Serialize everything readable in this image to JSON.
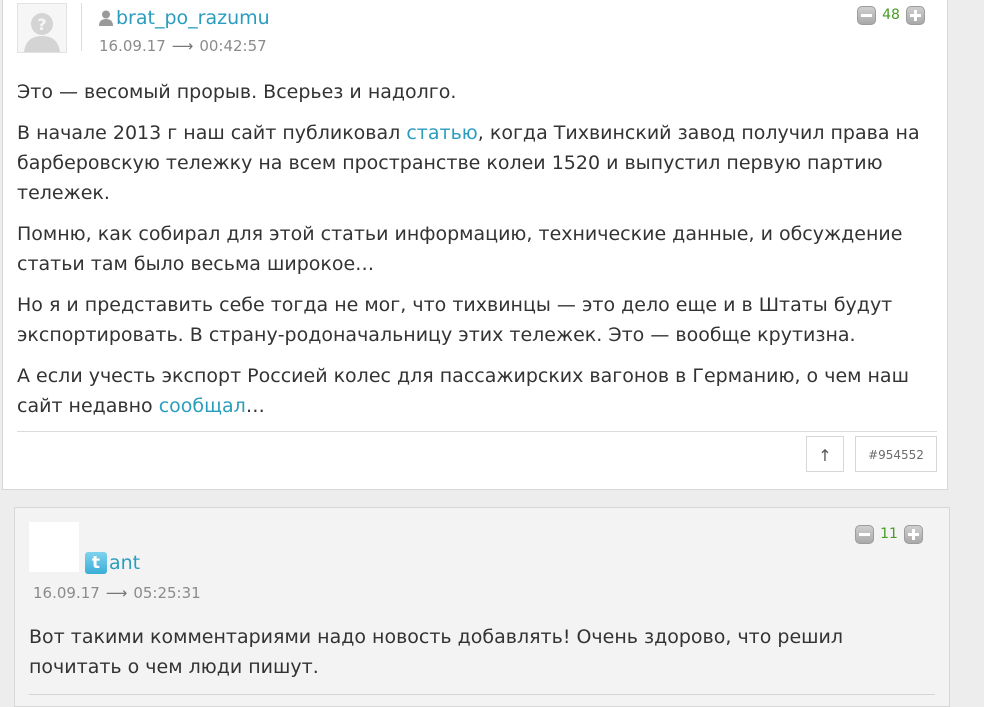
{
  "comment1": {
    "author": "brat_po_razumu",
    "date": "16.09.17",
    "time": "00:42:57",
    "arrow": "⟶",
    "rating": "48",
    "icons": {
      "author": "user-icon",
      "avatar": "default-avatar-icon",
      "minus": "minus-icon",
      "plus": "plus-icon"
    },
    "paragraphs": {
      "p1": "Это — весомый прорыв. Всерьез и надолго.",
      "p2_before": "В начале 2013 г наш сайт публиковал ",
      "p2_link": "статью",
      "p2_after": ", когда Тихвинский завод получил права на барберовскую тележку на всем пространстве колеи 1520 и выпустил первую партию тележек.",
      "p3": "Помню, как собирал для этой статьи информацию, технические данные, и обсуждение статьи там было весьма широкое…",
      "p4": "Но я и представить себе тогда не мог, что тихвинцы — это дело еще и в Штаты будут экспортировать. В страну-родоначальницу этих тележек. Это — вообще крутизна.",
      "p5_before": "А если учесть экспорт Россией колес для пассажирских вагонов в Германию, о чем наш сайт недавно ",
      "p5_link": "сообщал",
      "p5_after": "…"
    },
    "up_label": "↑",
    "permalink": "#954552"
  },
  "comment2": {
    "author": "ant",
    "date": "16.09.17",
    "time": "05:25:31",
    "arrow": "⟶",
    "rating": "11",
    "icons": {
      "author": "twitter-icon",
      "minus": "minus-icon",
      "plus": "plus-icon"
    },
    "twitter_glyph": "t",
    "text": "Вот такими комментариями надо новость добавлять! Очень здорово, что решил почитать о чем люди пишут."
  },
  "colors": {
    "link": "#2a9dbf",
    "rating": "#4a9a24",
    "meta": "#8b8b8b"
  }
}
